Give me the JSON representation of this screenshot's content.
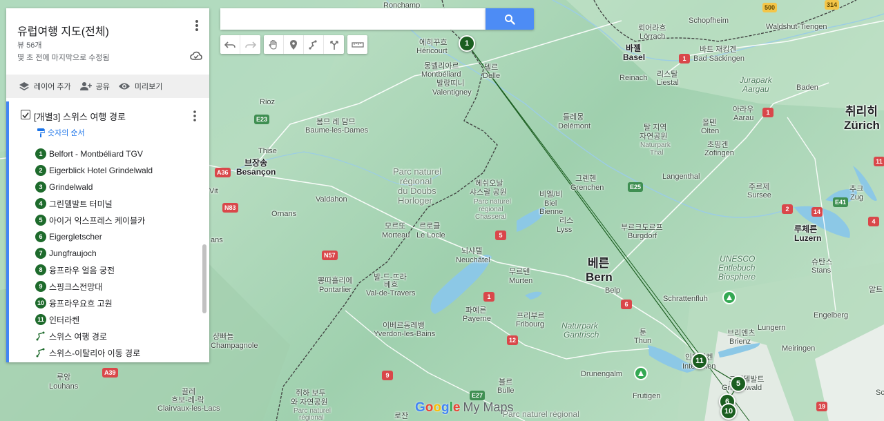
{
  "search": {
    "placeholder": "",
    "button_icon": "search-icon"
  },
  "toolbar": {
    "icons": [
      "undo-icon",
      "redo-icon",
      "hand-icon",
      "marker-icon",
      "draw-line-icon",
      "directions-icon",
      "ruler-icon"
    ]
  },
  "panel": {
    "title": "유럽여행 지도(전체)",
    "views": "뷰 56개",
    "modified": "몇 초 전에 마지막으로 수정됨",
    "actions": {
      "add_layer": "레이어 추가",
      "share": "공유",
      "preview": "미리보기"
    },
    "layer": {
      "checked": true,
      "title": "[개별3] 스위스 여행 경로",
      "style_link": "숫자의 순서",
      "items": [
        {
          "num": "1",
          "label": "Belfort - Montbéliard TGV"
        },
        {
          "num": "2",
          "label": "Eigerblick Hotel Grindelwald"
        },
        {
          "num": "3",
          "label": "Grindelwald"
        },
        {
          "num": "4",
          "label": "그린델발트 터미널"
        },
        {
          "num": "5",
          "label": "아이거 익스프레스 케이블카"
        },
        {
          "num": "6",
          "label": "Eigergletscher"
        },
        {
          "num": "7",
          "label": "Jungfraujoch"
        },
        {
          "num": "8",
          "label": "융프라우 얼음 궁전"
        },
        {
          "num": "9",
          "label": "스핑크스전망대"
        },
        {
          "num": "10",
          "label": "융프라우요흐 고원"
        },
        {
          "num": "11",
          "label": "인터라켄"
        }
      ],
      "routes": [
        {
          "label": "스위스 여행 경로"
        },
        {
          "label": "스위스-이탈리아 이동 경로"
        }
      ]
    }
  },
  "map": {
    "branding": {
      "google": [
        "G",
        "o",
        "o",
        "g",
        "l",
        "e"
      ],
      "mymaps": "My Maps"
    },
    "colors": {
      "route": "#1b5e20",
      "marker": "#1b5e20",
      "water": "#8cc8e6",
      "road_red": "#d9474a",
      "road_green": "#3f8f52",
      "border": "#3c3c3c"
    },
    "labels": {
      "ronchamp": "Ronchamp",
      "hericourt_ko": "에히꾸흐",
      "hericourt": "Héricourt",
      "montbeliard_ko": "몽벨리아르",
      "montbeliard": "Montbéliard",
      "valentigney_ko": "발랑띠니",
      "valentigney": "Valentigney",
      "delle_ko": "델르",
      "delle": "Delle",
      "rioz": "Rioz",
      "baume_ko": "봄므 레 담므",
      "baume": "Baume-les-Dames",
      "thise": "Thise",
      "besancon_ko": "브장송",
      "besancon": "Besançon",
      "valdahon": "Valdahon",
      "ornans": "Ornans",
      "vit": "Vit",
      "ans": "ans",
      "doubs_1": "Parc naturel",
      "doubs_2": "régional",
      "doubs_3": "du Doubs",
      "doubs_4": "Horloger",
      "chasseral_ko_1": "헤쉬오날",
      "chasseral_ko_2": "샤스랄 공원",
      "chasseral_1": "Parc naturel",
      "chasseral_2": "régional",
      "chasseral_3": "Chasseral",
      "morteau_ko": "모르또",
      "morteau": "Morteau",
      "lelocle_ko": "르로클",
      "lelocle": "Le Locle",
      "neuchatel_ko": "뇌샤텔",
      "neuchatel": "Neuchâtel",
      "pontarlier_ko": "뽕따흘리에",
      "pontarlier": "Pontarlier",
      "valdetravers_ko_1": "발-드-뜨라",
      "valdetravers_ko_2": "베흐",
      "valdetravers": "Val-de-Travers",
      "yverdon_ko": "이베르동레뱅",
      "yverdon": "Yverdon-les-Bains",
      "champagnole_ko": "샹빠뇰",
      "champagnole": "Champagnole",
      "louhans_ko": "루앙",
      "louhans": "Louhans",
      "clairvaux_ko": "끌레",
      "clairvaux_ko2": "흐보-레-락",
      "clairvaux": "Clairvaux-les-Lacs",
      "jura_ko_1": "쥐하 보두",
      "jura_ko_2": "와 자연공원",
      "jura_1": "Parc naturel",
      "jura_2": "régional",
      "rozan": "로잔",
      "payerne_ko": "파예른",
      "payerne": "Payerne",
      "fribourg_ko": "프리부르",
      "fribourg": "Fribourg",
      "murten_ko": "무르텐",
      "murten": "Murten",
      "bulle_ko": "블르",
      "bulle": "Bulle",
      "gruyere": "Parc naturel régional",
      "bern_ko": "베른",
      "bern": "Bern",
      "belp": "Belp",
      "gantrisch_1": "Naturpark",
      "gantrisch_2": "Gantrisch",
      "thun_ko": "툰",
      "thun": "Thun",
      "drunengalm": "Drunengalm",
      "frutigen": "Frutigen",
      "interlaken_ko": "인터라켄",
      "interlaken": "Interlaken",
      "grindelwald_ko": "그린델발트",
      "grindelwald": "Grindelwald",
      "brienz_ko": "브리엔츠",
      "brienz": "Brienz",
      "meiringen": "Meiringen",
      "lungern": "Lungern",
      "engelberg": "Engelberg",
      "entlebuch_1": "UNESCO",
      "entlebuch_2": "Entlebuch",
      "entlebuch_3": "Biosphere",
      "schrattenfluh": "Schrattenfluh",
      "stans_ko": "슈탄스",
      "stans": "Stans",
      "luzern_ko": "루체른",
      "luzern": "Luzern",
      "sursee_ko": "주르제",
      "sursee": "Sursee",
      "burgdorf_ko": "부르크도르프",
      "burgdorf": "Burgdorf",
      "biel_ko": "비엘/비",
      "biel": "Biel",
      "bienne": "Bienne",
      "lyss_ko": "리스",
      "lyss": "Lyss",
      "grenchen_ko": "그렌헨",
      "grenchen": "Grenchen",
      "delemont_ko": "들레몽",
      "delemont": "Delémont",
      "thal_ko_1": "탈 지역",
      "thal_ko_2": "자연공원",
      "thal_1": "Naturpark",
      "thal_2": "Thal",
      "olten_ko": "올텐",
      "olten": "Olten",
      "zofingen_ko": "초핑겐",
      "zofingen": "Zofingen",
      "langenthal": "Langenthal",
      "aarau_ko": "아라우",
      "aarau": "Aarau",
      "jurapark_1": "Jurapark",
      "jurapark_2": "Aargau",
      "baden": "Baden",
      "zurich_ko": "취리히",
      "zurich": "Zürich",
      "zug_ko": "추크",
      "zug": "Zug",
      "liestal_ko": "리스탈",
      "liestal": "Liestal",
      "basel_ko": "바젤",
      "basel": "Basel",
      "reinach": "Reinach",
      "lorrach_ko": "뢰어라흐",
      "lorrach": "Lörrach",
      "schopfheim": "Schopfheim",
      "badsackingen_ko": "바트 재킹겐",
      "badsackingen": "Bad Säckingen",
      "waldshut": "Waldshut-Tiengen",
      "altdorf": "알트",
      "schwyz": "Sc"
    },
    "roads": {
      "e23": "E23",
      "a36": "A36",
      "n83": "N83",
      "n57": "N57",
      "e25": "E25",
      "e41": "E41",
      "a39": "A39",
      "e27": "E27",
      "r1": "1",
      "r2": "2",
      "r4": "4",
      "r5": "5",
      "r6": "6",
      "r9": "9",
      "r11": "11",
      "r12": "12",
      "r14": "14",
      "r19": "19",
      "r314": "314",
      "r500": "500"
    },
    "markers": [
      "1",
      "11",
      "5",
      "6",
      "10"
    ]
  }
}
